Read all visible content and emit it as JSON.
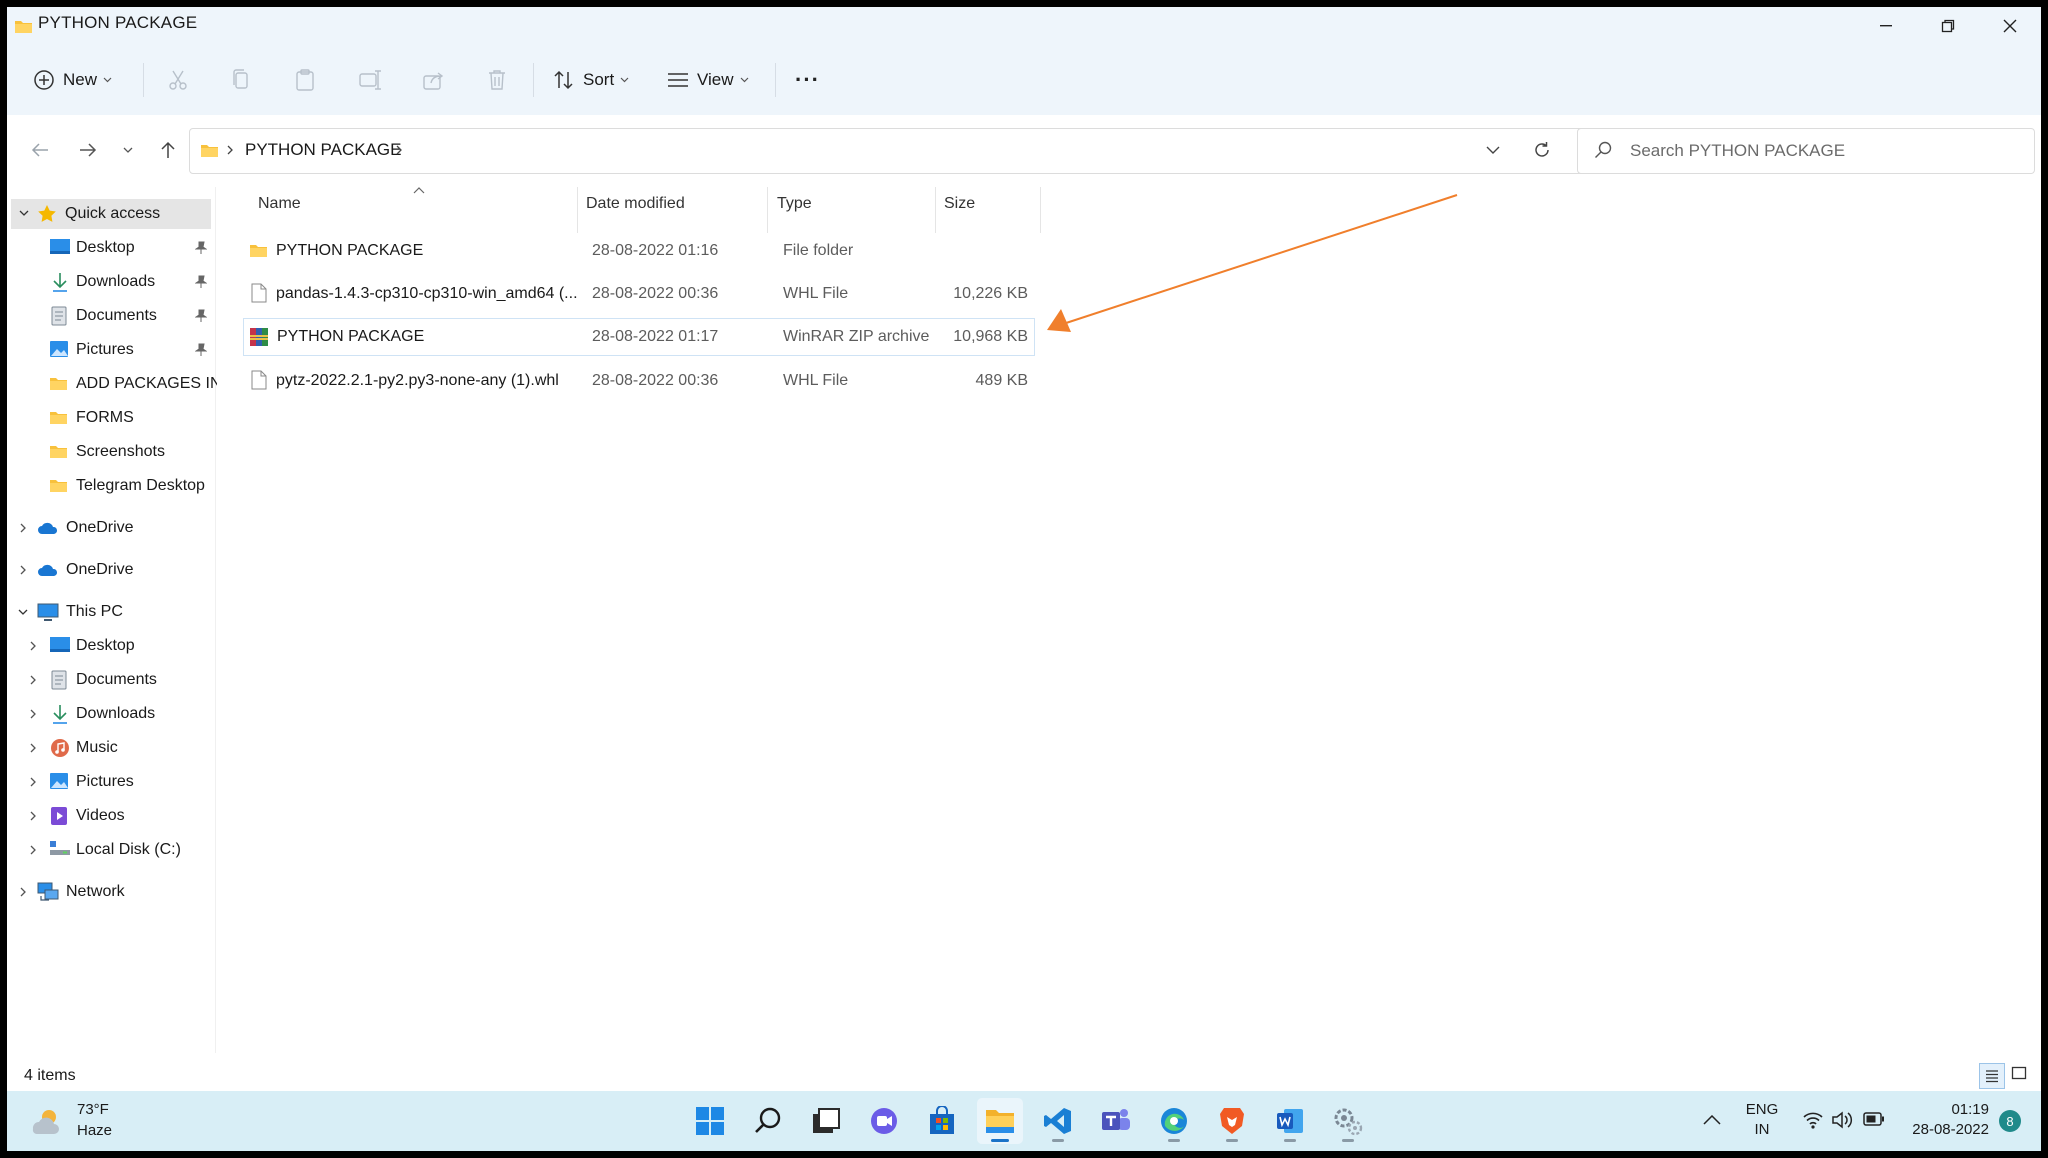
{
  "window": {
    "title": "PYTHON PACKAGE"
  },
  "toolbar": {
    "new_label": "New",
    "sort_label": "Sort",
    "view_label": "View",
    "more_label": "···"
  },
  "address": {
    "crumb": "PYTHON PACKAGE"
  },
  "search": {
    "placeholder": "Search PYTHON PACKAGE"
  },
  "sidebar": {
    "quick_access": "Quick access",
    "quick_items": [
      "Desktop",
      "Downloads",
      "Documents",
      "Pictures",
      "ADD PACKAGES IN",
      "FORMS",
      "Screenshots",
      "Telegram Desktop"
    ],
    "onedrive_1": "OneDrive",
    "onedrive_2": "OneDrive",
    "this_pc": "This PC",
    "pc_items": [
      "Desktop",
      "Documents",
      "Downloads",
      "Music",
      "Pictures",
      "Videos",
      "Local Disk (C:)"
    ],
    "network": "Network"
  },
  "columns": {
    "name": "Name",
    "date": "Date modified",
    "type": "Type",
    "size": "Size"
  },
  "files": [
    {
      "name": "PYTHON PACKAGE",
      "date": "28-08-2022 01:16",
      "type": "File folder",
      "size": "",
      "icon": "folder-icon"
    },
    {
      "name": "pandas-1.4.3-cp310-cp310-win_amd64 (...",
      "date": "28-08-2022 00:36",
      "type": "WHL File",
      "size": "10,226 KB",
      "icon": "file-icon"
    },
    {
      "name": "PYTHON PACKAGE",
      "date": "28-08-2022 01:17",
      "type": "WinRAR ZIP archive",
      "size": "10,968 KB",
      "icon": "winrar-icon"
    },
    {
      "name": "pytz-2022.2.1-py2.py3-none-any (1).whl",
      "date": "28-08-2022 00:36",
      "type": "WHL File",
      "size": "489 KB",
      "icon": "file-icon"
    }
  ],
  "status": {
    "count": "4 items"
  },
  "taskbar": {
    "weather_temp": "73°F",
    "weather_desc": "Haze",
    "lang_1": "ENG",
    "lang_2": "IN",
    "time": "01:19",
    "date": "28-08-2022",
    "notif_count": "8"
  },
  "colors": {
    "accent": "#0067c0",
    "folder": "#f8c13c",
    "arrow": "#f07f2c",
    "taskbar": "#d8eef6",
    "chrome": "#eef5fb"
  }
}
